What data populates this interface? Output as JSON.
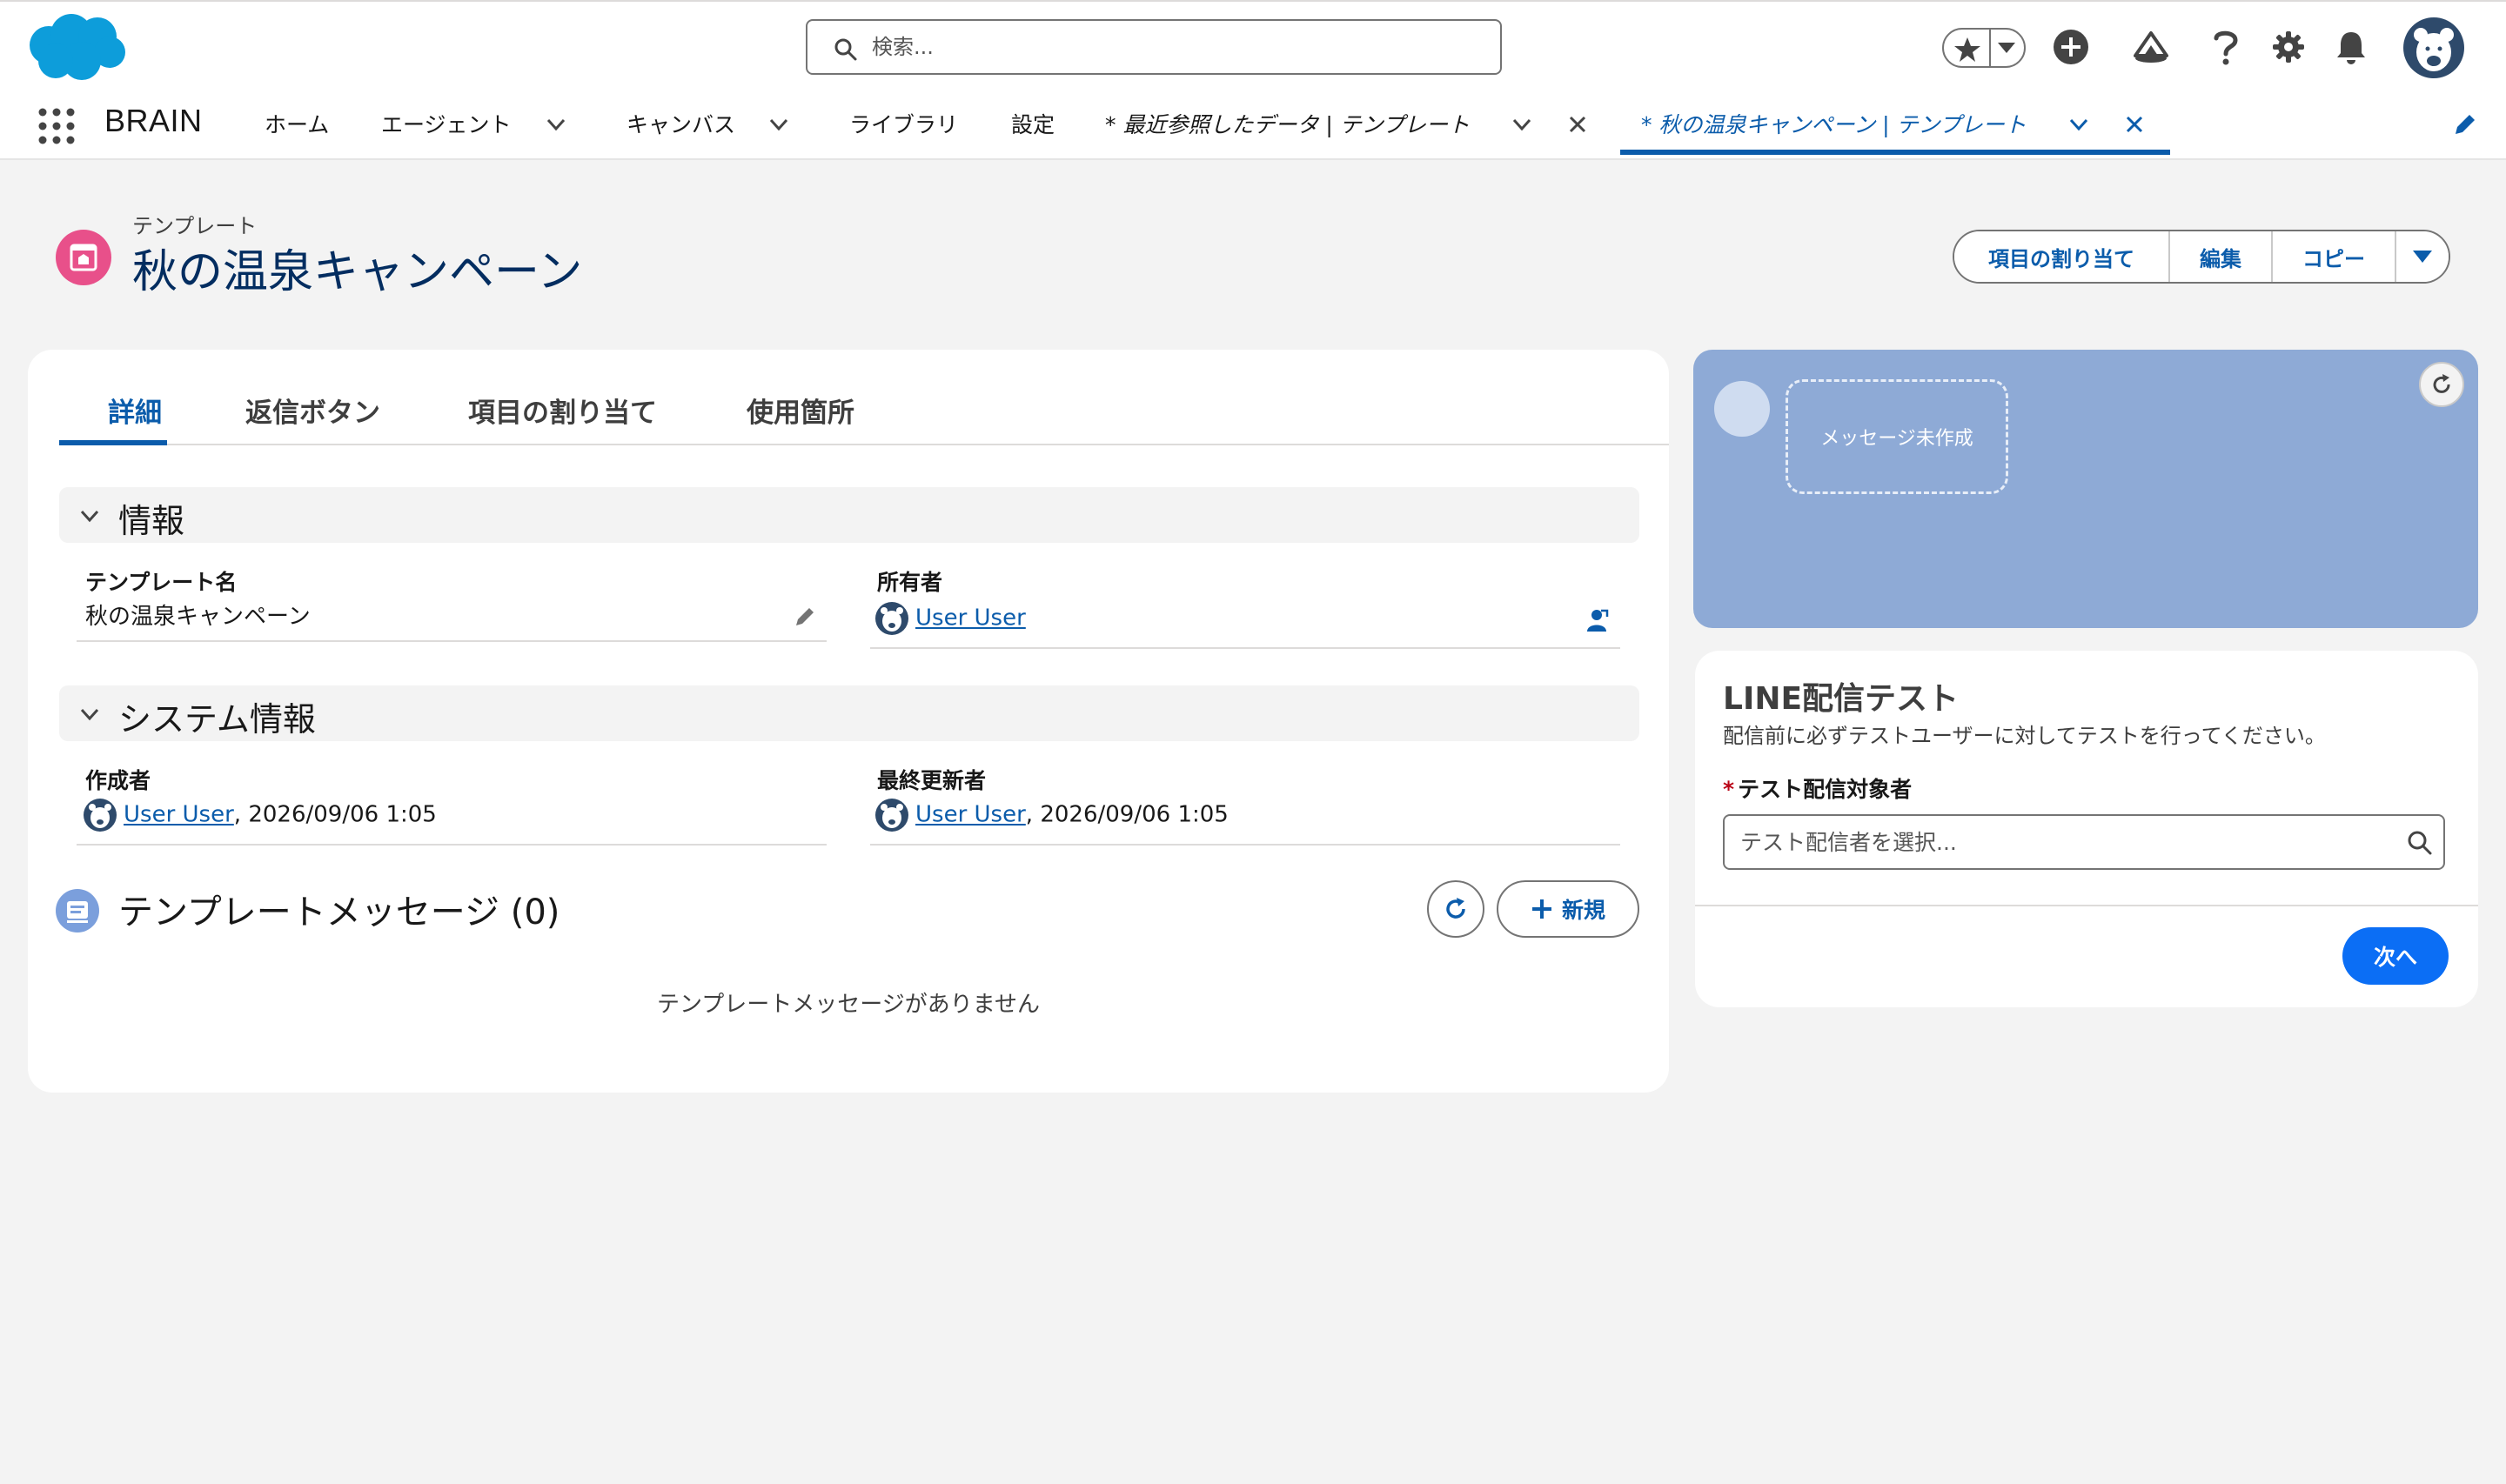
{
  "header": {
    "search_placeholder": "検索..."
  },
  "nav": {
    "app_name": "BRAIN",
    "items": [
      {
        "label": "ホーム"
      },
      {
        "label": "エージェント"
      },
      {
        "label": "キャンバス"
      },
      {
        "label": "ライブラリ"
      },
      {
        "label": "設定"
      }
    ],
    "open_tabs": [
      {
        "label": "* 最近参照したデータ | テンプレート"
      },
      {
        "label": "* 秋の温泉キャンペーン | テンプレート"
      }
    ]
  },
  "page_header": {
    "object_label": "テンプレート",
    "title": "秋の温泉キャンペーン",
    "actions": [
      "項目の割り当て",
      "編集",
      "コピー"
    ]
  },
  "tabs": [
    "詳細",
    "返信ボタン",
    "項目の割り当て",
    "使用箇所"
  ],
  "sections": {
    "info": {
      "title": "情報",
      "template_name_label": "テンプレート名",
      "template_name_value": "秋の温泉キャンペーン",
      "owner_label": "所有者",
      "owner_value": "User User"
    },
    "system": {
      "title": "システム情報",
      "created_by_label": "作成者",
      "created_by_user": "User User",
      "created_by_date": ", 2026/09/06 1:05",
      "modified_by_label": "最終更新者",
      "modified_by_user": "User User",
      "modified_by_date": ", 2026/09/06 1:05"
    }
  },
  "related": {
    "title": "テンプレートメッセージ (0)",
    "new_label": "新規",
    "empty_text": "テンプレートメッセージがありません"
  },
  "preview": {
    "bubble_text": "メッセージ未作成"
  },
  "test": {
    "title": "LINE配信テスト",
    "description": "配信前に必ずテストユーザーに対してテストを行ってください。",
    "required_mark": "*",
    "field_label": "テスト配信対象者",
    "placeholder": "テスト配信者を選択...",
    "next_label": "次へ"
  },
  "colors": {
    "brand": "#0b5cab",
    "cloud": "#0d9dda",
    "record_icon": "#e8508a",
    "preview_bg": "#8eaad6",
    "primary_button": "#0b6ef5"
  }
}
